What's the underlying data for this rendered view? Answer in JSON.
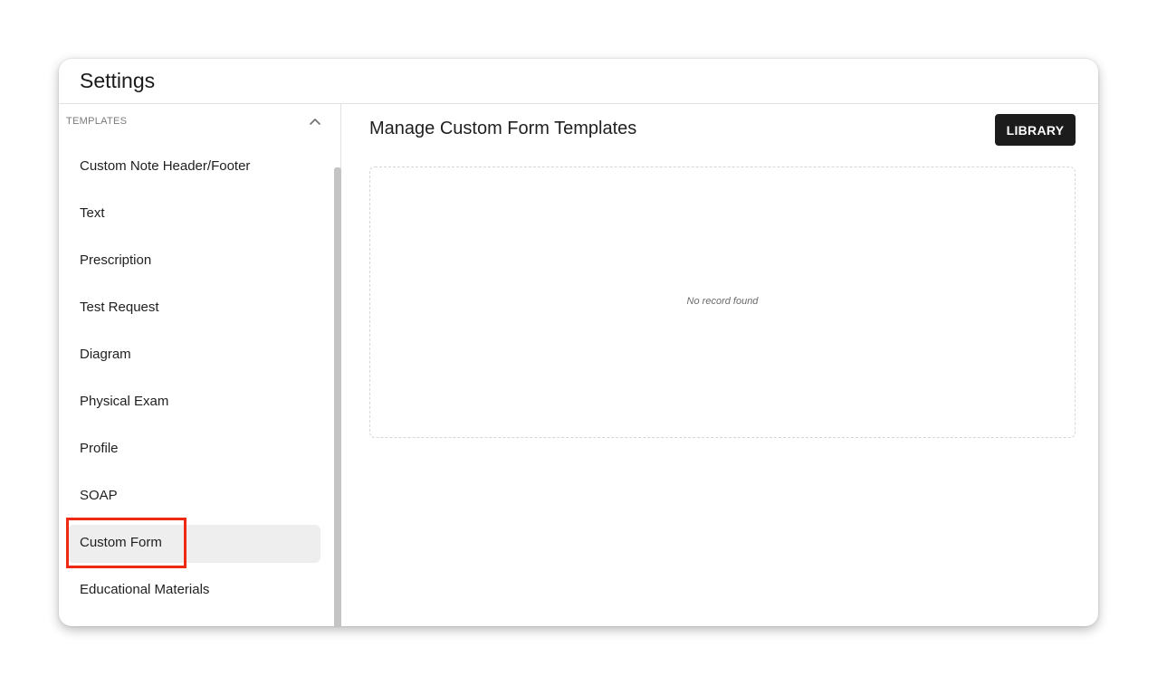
{
  "window": {
    "title": "Settings"
  },
  "sidebar": {
    "section_label": "TEMPLATES",
    "section_icon": "chevron-up-icon",
    "items": [
      {
        "label": "Custom Note Header/Footer"
      },
      {
        "label": "Text"
      },
      {
        "label": "Prescription"
      },
      {
        "label": "Test Request"
      },
      {
        "label": "Diagram"
      },
      {
        "label": "Physical Exam"
      },
      {
        "label": "Profile"
      },
      {
        "label": "SOAP"
      },
      {
        "label": "Custom Form",
        "selected": true
      },
      {
        "label": "Educational Materials"
      }
    ]
  },
  "main": {
    "heading": "Manage Custom Form Templates",
    "library_label": "LIBRARY",
    "empty_text": "No record found"
  },
  "colors": {
    "highlight": "#ee2a12",
    "button_bg": "#1c1c1c",
    "selected_bg": "#eeeeee"
  }
}
